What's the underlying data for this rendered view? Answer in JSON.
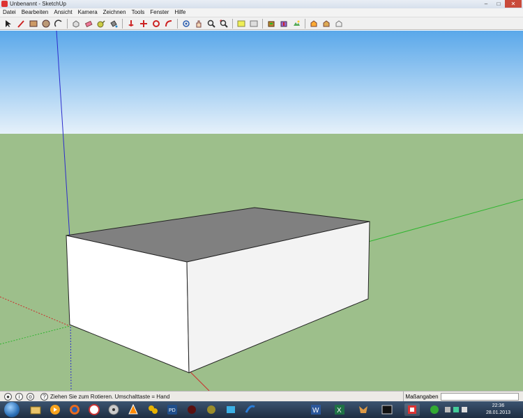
{
  "window": {
    "title": "Unbenannt - SketchUp",
    "controls": {
      "minimize": "–",
      "maximize": "□",
      "close": "✕"
    }
  },
  "menubar": {
    "items": [
      {
        "label": "Datei"
      },
      {
        "label": "Bearbeiten"
      },
      {
        "label": "Ansicht"
      },
      {
        "label": "Kamera"
      },
      {
        "label": "Zeichnen"
      },
      {
        "label": "Tools"
      },
      {
        "label": "Fenster"
      },
      {
        "label": "Hilfe"
      }
    ]
  },
  "toolbar": {
    "groups": [
      [
        "select-icon",
        "line-icon",
        "rectangle-icon",
        "circle-icon",
        "arc-icon"
      ],
      [
        "make-component-icon",
        "eraser-icon",
        "tape-measure-icon",
        "paint-bucket-icon"
      ],
      [
        "push-pull-icon",
        "move-icon",
        "rotate-icon",
        "follow-me-icon"
      ],
      [
        "orbit-icon",
        "pan-icon",
        "zoom-icon",
        "zoom-extents-icon"
      ],
      [
        "add-location-icon",
        "toggle-terrain-icon"
      ],
      [
        "get-models-icon",
        "share-model-icon",
        "photo-textures-icon"
      ],
      [
        "get-models-warehouse-icon",
        "share-component-icon",
        "extension-warehouse-icon"
      ]
    ]
  },
  "statusbar": {
    "message": "Ziehen Sie zum Rotieren.  Umschalttaste = Hand",
    "measurements_label": "Maßangaben",
    "measurements_value": ""
  },
  "colors": {
    "sky_top": "#5aa8ea",
    "sky_bottom": "#e6f1fa",
    "ground": "#9dbf8b",
    "box_top": "#808080",
    "box_side": "#ffffff",
    "box_front": "#f3f3f3",
    "axis_red": "#cc2b2b",
    "axis_green": "#2fb52f",
    "axis_blue": "#2c2ccc"
  },
  "taskbar": {
    "clock_time": "22:36",
    "clock_date": "28.01.2013",
    "apps": [
      "explorer-icon",
      "media-player-icon",
      "firefox-icon",
      "browser-icon",
      "cd-icon",
      "vlc-icon",
      "app-icon",
      "pd-icon",
      "app-icon-2",
      "app-icon-3",
      "app-icon-4",
      "word-icon",
      "excel-icon",
      "app-icon-5",
      "terminal-icon",
      "sketchup-icon",
      "app-icon-6"
    ]
  }
}
